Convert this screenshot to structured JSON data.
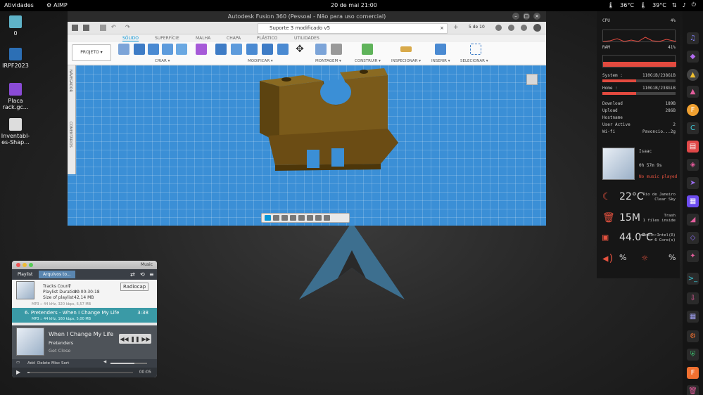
{
  "topbar": {
    "activities": "Atividades",
    "app": "AIMP",
    "clock": "20 de mai  21:00",
    "temp1": "36°C",
    "temp2": "39°C",
    "status_icons": [
      "network-icon",
      "volume-icon",
      "power-icon"
    ]
  },
  "desktop": {
    "icons": [
      {
        "label": "0",
        "icon": "folder-icon"
      },
      {
        "label": "IRPF2023",
        "icon": "document-icon"
      },
      {
        "label": "Placa rack.gc...",
        "icon": "text-file-icon"
      },
      {
        "label": "Inventabl-es-Shap...",
        "icon": "image-file-icon"
      }
    ]
  },
  "fusion": {
    "window_title": "Autodesk Fusion 360 (Pessoal - Não para uso comercial)",
    "doc_tab": "Suporte 3 modificado v5",
    "page_count": "5 de 10",
    "ribbon_tabs": [
      "SÓLIDO",
      "SUPERFÍCIE",
      "MALHA",
      "CHAPA",
      "PLÁSTICO",
      "UTILIDADES"
    ],
    "project_button": "PROJETO ▾",
    "groups": [
      "CRIAR ▾",
      "MODIFICAR ▾",
      "MONTAGEM ▾",
      "CONSTRUIR ▾",
      "INSPECIONAR ▾",
      "INSERIR ▾",
      "SELECIONAR ▾"
    ],
    "browser_labels": [
      "NAVEGADOR",
      "COMENTÁRIOS"
    ]
  },
  "conky": {
    "cpu_label": "CPU",
    "cpu_value": "4%",
    "ram_label": "RAM",
    "ram_value": "41%",
    "system_label": "System :",
    "system_value": "110GiB/238GiB",
    "home_label": "Home :",
    "home_value": "110GiB/238GiB",
    "system_fraction": 0.46,
    "home_fraction": 0.46,
    "download_label": "Download",
    "download_value": "189B",
    "upload_label": "Upload",
    "upload_value": "286B",
    "hostname_label": "Hostname",
    "hostname_value": "",
    "users_label": "User Active",
    "users_value": "2",
    "wifi_label": "Wi-fi",
    "wifi_value": "Pavoncio...2g",
    "user_name": "Isaac",
    "uptime": "0h 57m 9s",
    "music_status": "No music played",
    "weather_temp": "22°C",
    "weather_city": "Rio de Janeiro",
    "weather_cond": "Clear Sky",
    "trash_size": "15M",
    "trash_label": "Trash",
    "trash_files": "1 files inside",
    "cpu_temp": "44.0°C",
    "cpu_model": "modelo:Intel(R)",
    "cpu_cores": "6 Core(s)",
    "volume": "%",
    "brightness": "%"
  },
  "aimp": {
    "header_title": "Music",
    "tab_playlist": "Playlist",
    "tab_files": "Arquivos to...",
    "tracks_count_label": "Tracks Count",
    "tracks_count": "7",
    "duration_label": "Playlist Duration",
    "duration": "00:00:30:18",
    "size_label": "Size of playlist",
    "size": "42,14 MB",
    "radio_button": "Radiocap",
    "track_meta_top": "MP3 :: 44 kHz, 320 kbps, 6,57 MB",
    "track_active": "6.  Pretenders - When I Change My Life",
    "track_active_time": "3:38",
    "track_active_meta": "MP3 :: 44 kHz, 160 kbps, 5,00 MB",
    "now_title": "When I Change My Life",
    "now_artist": "Pretenders",
    "now_album": "Get Close",
    "tool_add": "Add",
    "tool_delete": "Delete",
    "tool_misc": "Misc",
    "tool_sort": "Sort",
    "elapsed": "00:05",
    "progress_fraction": 0.02,
    "volume_fraction": 0.65
  }
}
